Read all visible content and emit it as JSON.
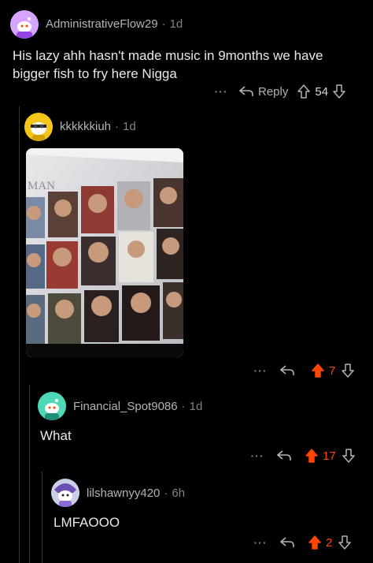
{
  "comments": [
    {
      "username": "AdministrativeFlow29",
      "age": "1d",
      "body": "His lazy ahh hasn't made music in 9months we have bigger fish to fry here Nigga",
      "reply_label": "Reply",
      "votes": "54",
      "avatar_color": "#c084fc"
    },
    {
      "username": "kkkkkkiuh",
      "age": "1d",
      "image_text": "MAN",
      "votes": "7",
      "avatar_color": "#f5c518"
    },
    {
      "username": "Financial_Spot9086",
      "age": "1d",
      "body": "What",
      "votes": "17",
      "avatar_color": "#3fd0b0"
    },
    {
      "username": "lilshawnyy420",
      "age": "6h",
      "body": "LMFAOOO",
      "votes": "2",
      "avatar_color": "#9aa4c4"
    }
  ],
  "colors": {
    "upvote_active": "#ff4500",
    "background": "#000000",
    "thread_line": "#343536"
  }
}
